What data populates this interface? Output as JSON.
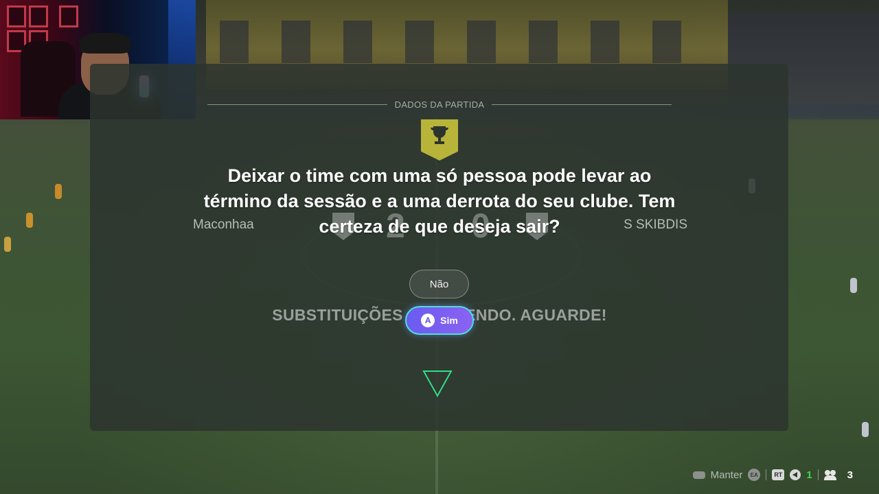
{
  "match_panel": {
    "header": "DADOS DA PARTIDA",
    "home_team": "Maconhaa",
    "away_team": "S SKIBDIS",
    "home_score": "2",
    "away_score": "0",
    "subs_banner": "SUBSTITUIÇÕES AQUECENDO. AGUARDE!"
  },
  "dialog": {
    "message": "Deixar o time com uma só pessoa pode levar ao término da sessão e a uma derrota do seu clube. Tem certeza de que deseja sair?",
    "no_label": "Não",
    "yes_label": "Sim",
    "yes_button_glyph": "A",
    "colors": {
      "yes_gradient_start": "#6a5cf0",
      "yes_gradient_end": "#8a62f2",
      "yes_border": "#4ce0d8"
    }
  },
  "hud": {
    "hold_label": "Manter",
    "ea_glyph": "EA",
    "rt_glyph": "RT",
    "voice_count": "1",
    "players_count": "3",
    "icons": [
      "controller-icon",
      "ea-icon",
      "rt-trigger-icon",
      "speaker-icon",
      "players-icon"
    ],
    "colors": {
      "voice_count": "#3fd84f",
      "trophy": "#b8b43a"
    }
  }
}
